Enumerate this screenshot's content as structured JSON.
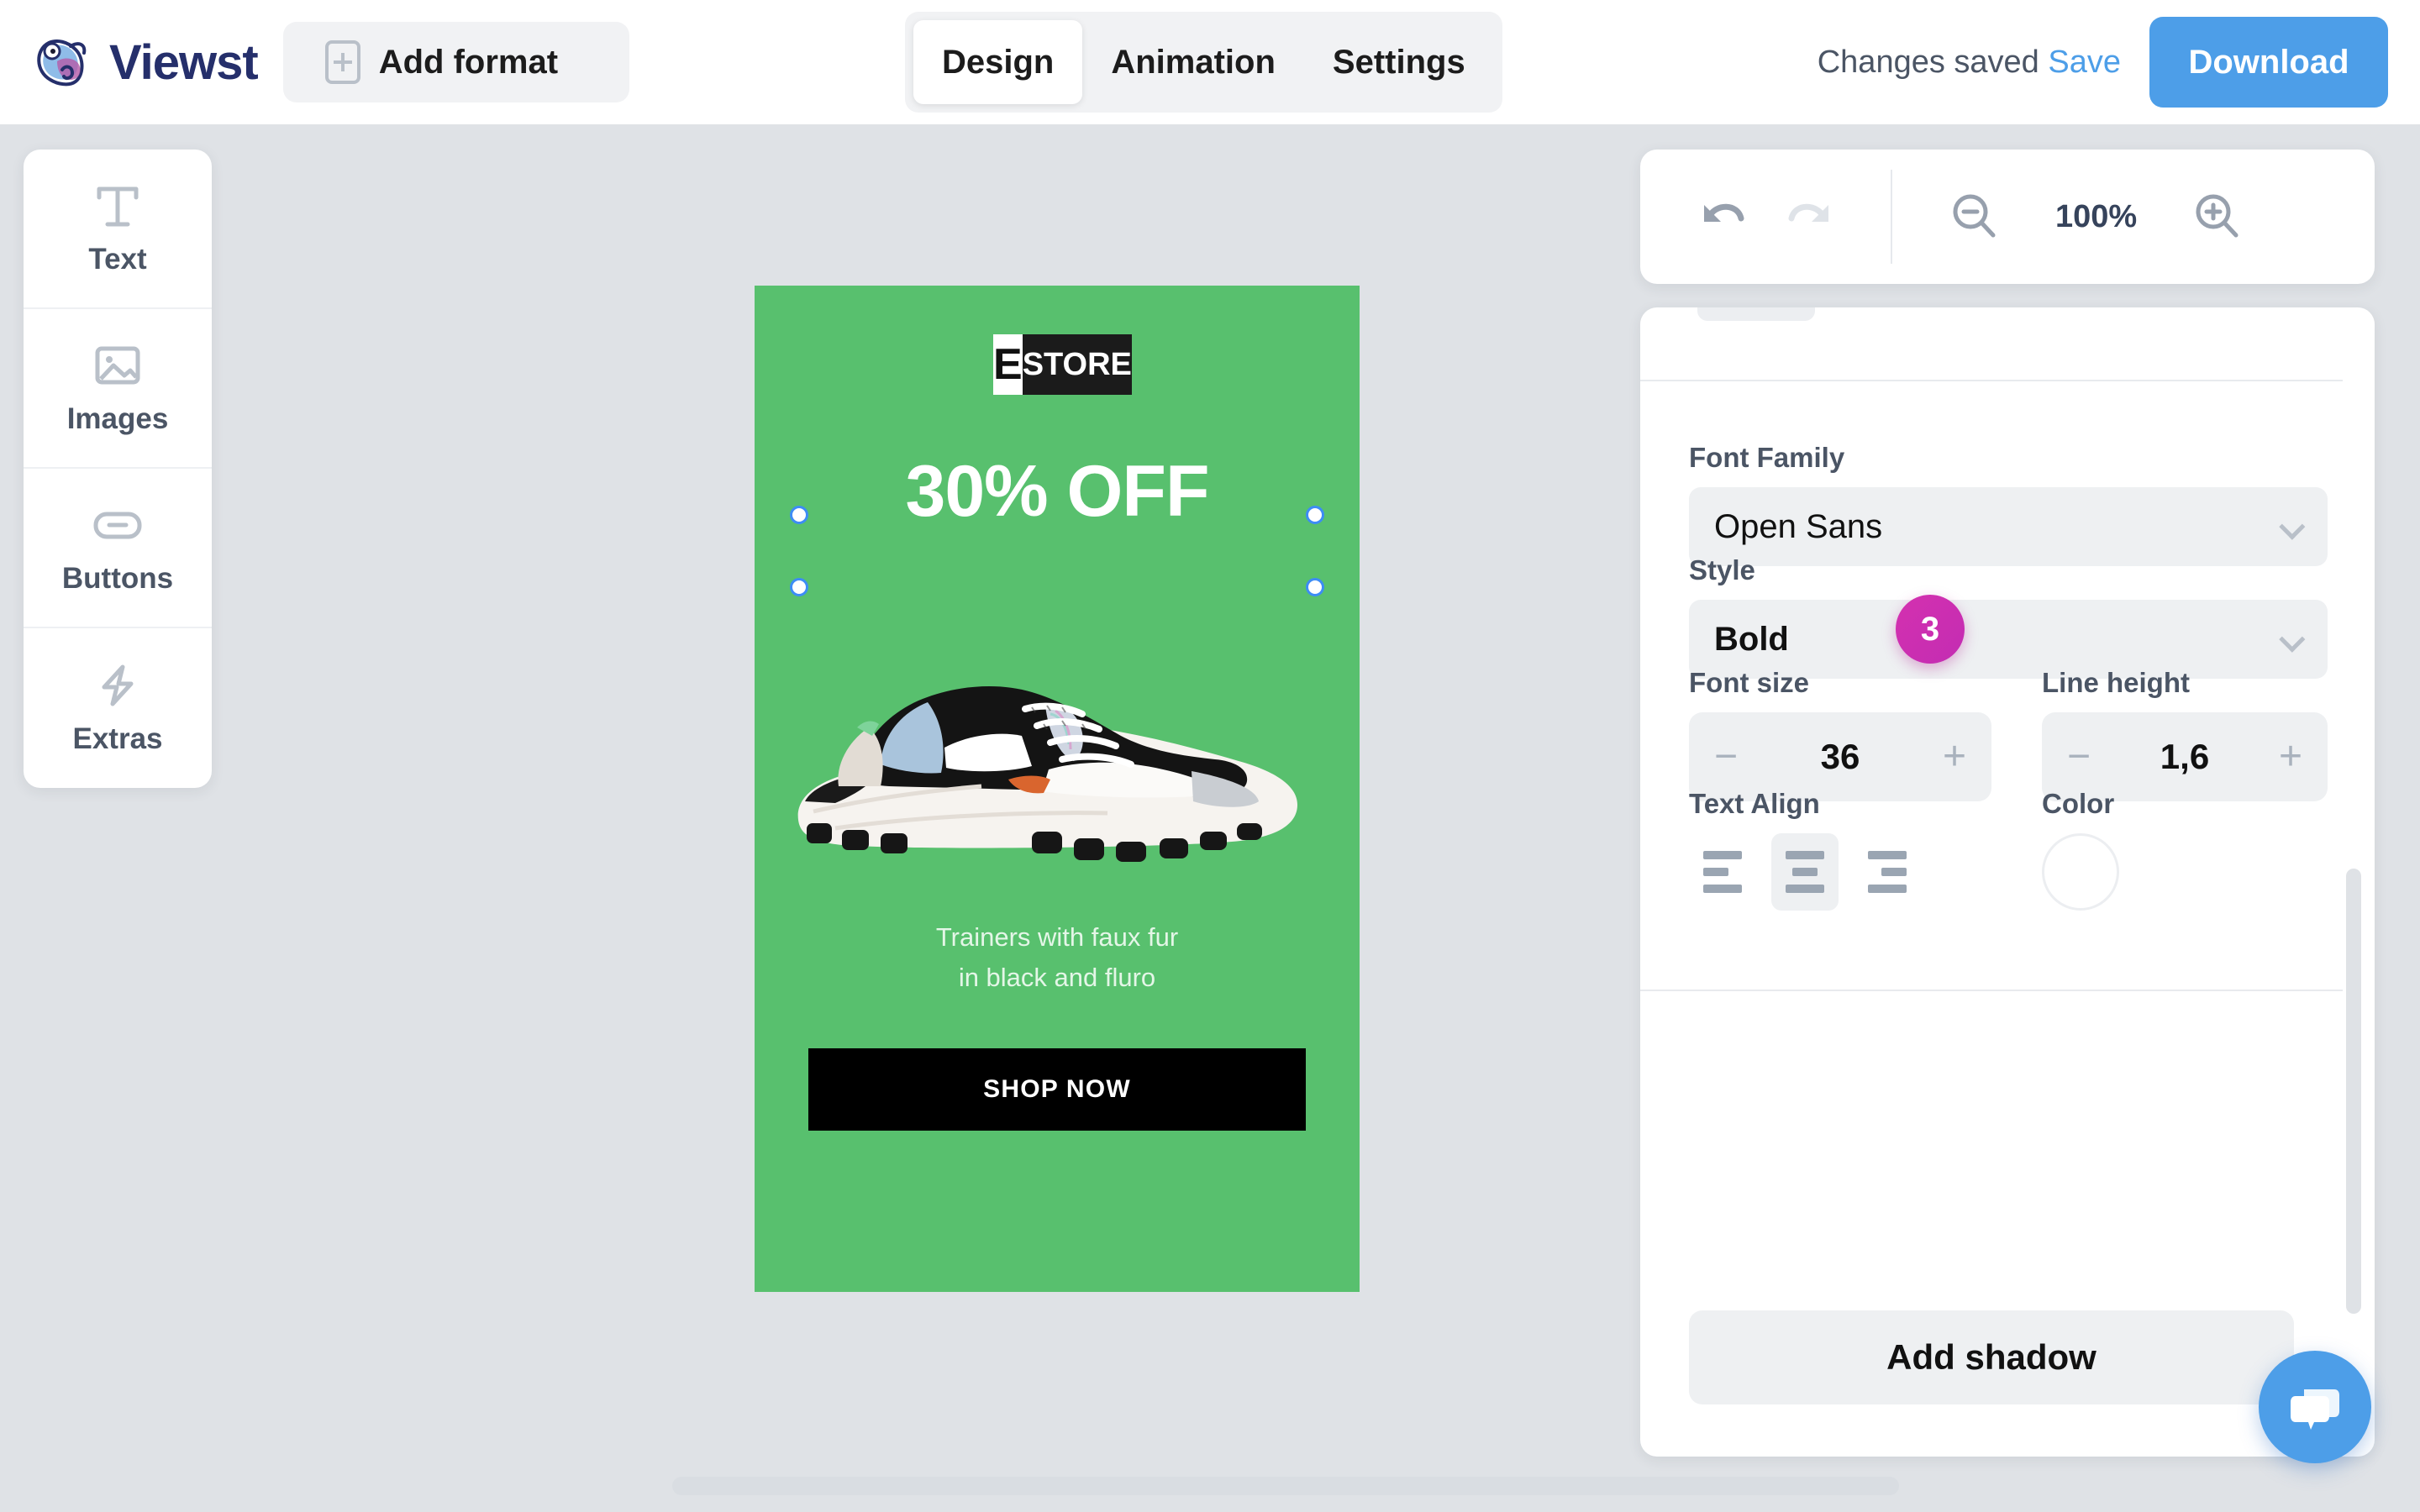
{
  "header": {
    "brand_name": "Viewst",
    "brand_logo_icon": "chameleon-logo-icon",
    "add_format_label": "Add format",
    "add_format_icon": "plus-frame-icon",
    "tabs": [
      {
        "label": "Design",
        "active": true
      },
      {
        "label": "Animation",
        "active": false
      },
      {
        "label": "Settings",
        "active": false
      }
    ],
    "save_status": "Changes saved",
    "save_link": "Save",
    "download_label": "Download"
  },
  "left_toolbar": {
    "items": [
      {
        "label": "Text",
        "icon": "text-t-icon"
      },
      {
        "label": "Images",
        "icon": "image-picture-icon"
      },
      {
        "label": "Buttons",
        "icon": "rounded-button-icon"
      },
      {
        "label": "Extras",
        "icon": "lightning-bolt-icon"
      }
    ]
  },
  "zoom_bar": {
    "undo_icon": "undo-arrow-icon",
    "redo_icon": "redo-arrow-icon",
    "zoom_out_icon": "magnifier-minus-icon",
    "zoom_in_icon": "magnifier-plus-icon",
    "zoom_value": "100%"
  },
  "canvas": {
    "background_color": "#58c06e",
    "logo_mark": "E",
    "logo_word": "STORE",
    "headline": "30% OFF",
    "product_image": "white-black-chunky-sneaker-photo",
    "subtext_line1": "Trainers with faux fur",
    "subtext_line2": "in black and fluro",
    "cta_label": "SHOP NOW",
    "cta_background": "#000000",
    "selection_handles": 4
  },
  "properties": {
    "font_family_label": "Font Family",
    "font_family_value": "Open Sans",
    "style_label": "Style",
    "style_value": "Bold",
    "step_badge": "3",
    "step_badge_color": "#c92cb0",
    "font_size_label": "Font size",
    "font_size_value": "36",
    "line_height_label": "Line height",
    "line_height_value": "1,6",
    "minus_label": "−",
    "plus_label": "+",
    "text_align_label": "Text Align",
    "text_align_options": [
      "left",
      "center",
      "right"
    ],
    "text_align_selected": "center",
    "color_label": "Color",
    "color_value": "#ffffff",
    "add_shadow_label": "Add shadow"
  },
  "chat": {
    "icon": "chat-bubble-icon",
    "color": "#4d9ee8"
  }
}
